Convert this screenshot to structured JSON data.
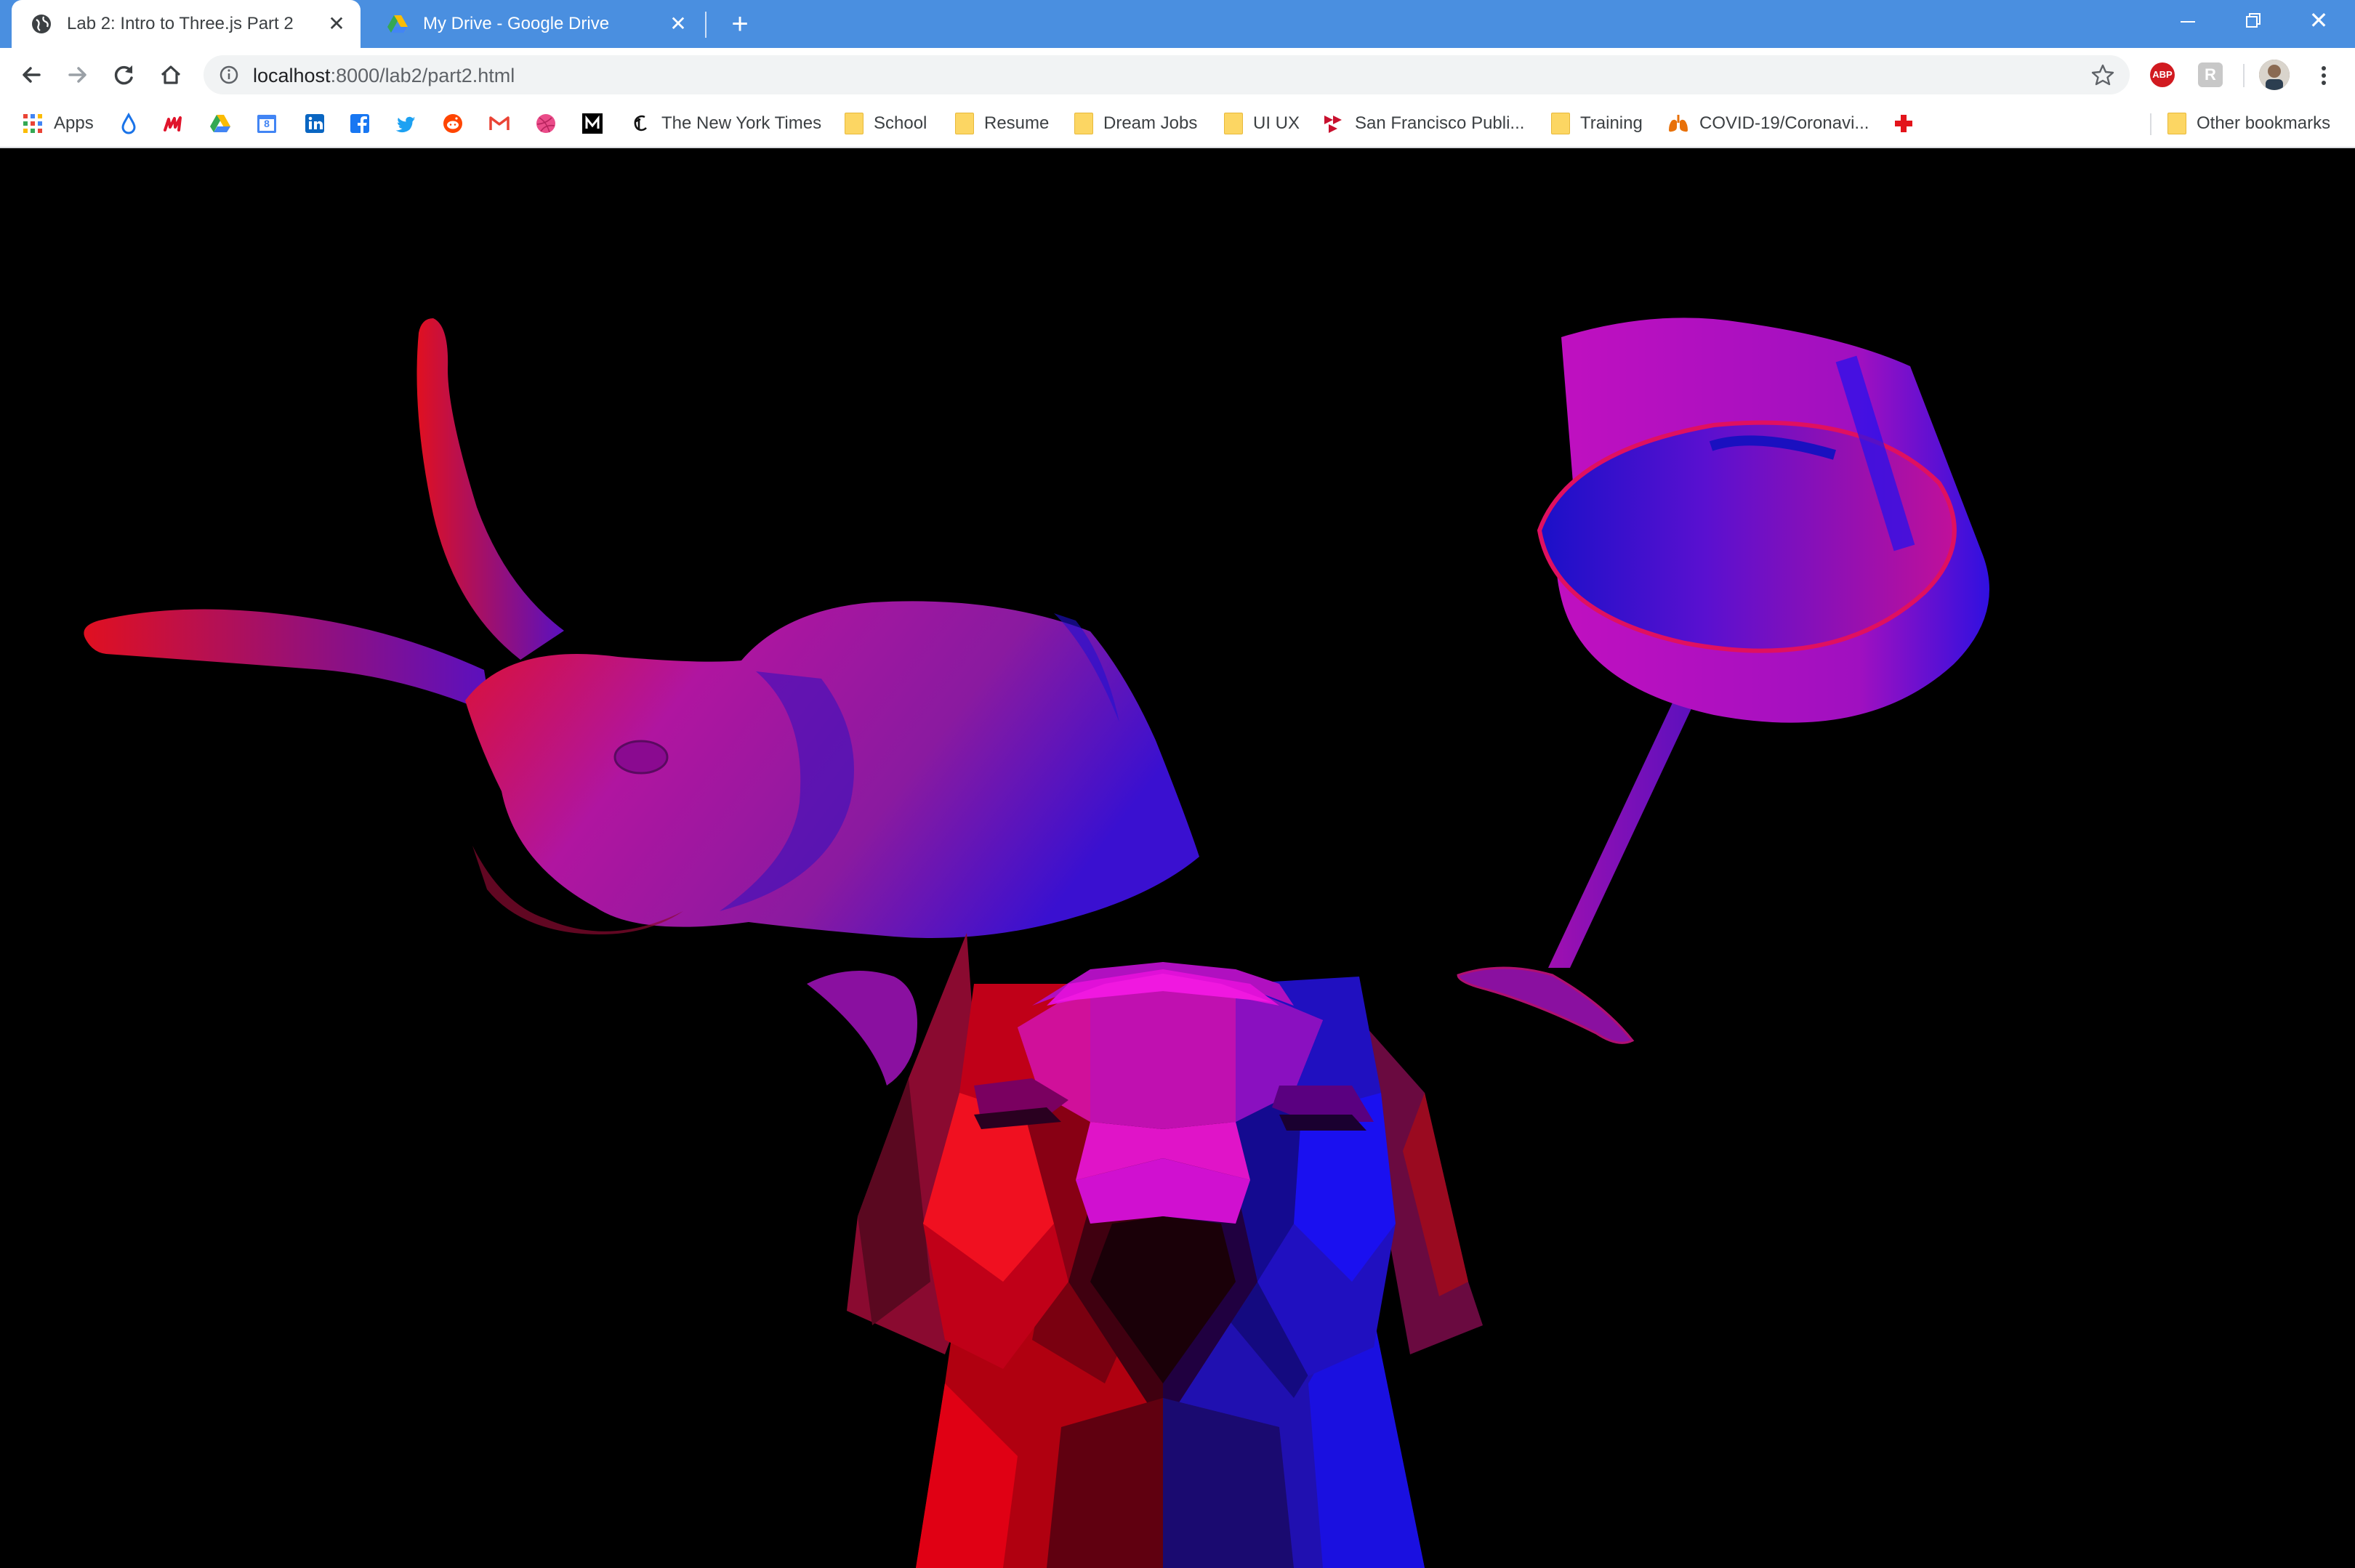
{
  "tabs": [
    {
      "title": "Lab 2: Intro to Three.js Part 2",
      "active": true,
      "favicon": "globe-icon",
      "close": "✕"
    },
    {
      "title": "My Drive - Google Drive",
      "active": false,
      "favicon": "google-drive-icon",
      "close": "✕"
    }
  ],
  "window": {
    "new_tab": "+",
    "minimize": "—",
    "restore": "❐",
    "close": "✕"
  },
  "address": {
    "host": "localhost",
    "path": ":8000/lab2/part2.html"
  },
  "toolbar": {
    "back": "back-arrow-icon",
    "forward": "forward-arrow-icon",
    "reload": "reload-icon",
    "home": "home-icon",
    "bookmark": "star-icon",
    "menu": "kebab-menu-icon"
  },
  "extensions": {
    "abp": "ABP",
    "gray": "R"
  },
  "bookmarks": {
    "apps": "Apps",
    "nyt": "The New York Times",
    "school": "School",
    "resume": "Resume",
    "dream_jobs": "Dream Jobs",
    "ui_ux": "UI UX",
    "sf_library": "San Francisco Publi...",
    "training": "Training",
    "covid": "COVID-19/Coronavi...",
    "other": "Other bookmarks",
    "calendar_day": "8",
    "icons": [
      "water-drop-icon",
      "m-logo-icon",
      "google-drive-icon",
      "google-calendar-icon",
      "linkedin-icon",
      "facebook-icon",
      "twitter-icon",
      "reddit-icon",
      "gmail-icon",
      "dribbble-icon",
      "medium-icon",
      "nyt-icon",
      "sf-library-icon",
      "lungs-icon",
      "red-cross-icon"
    ]
  },
  "colors": {
    "tabstrip": "#4a8fe0",
    "scene_background": "#000000",
    "red": "#e00010",
    "blue": "#1a10e0",
    "magenta": "#d010d0"
  },
  "scene": {
    "objects": [
      "bunny",
      "lamp",
      "dog-head"
    ]
  }
}
